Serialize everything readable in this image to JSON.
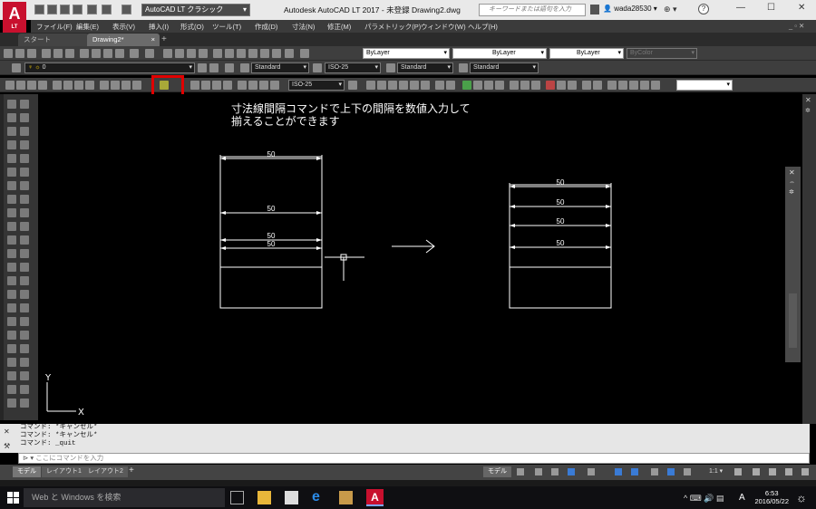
{
  "app": {
    "logo": "A",
    "logo_sub": "LT",
    "workspace": "AutoCAD LT クラシック",
    "title": "Autodesk AutoCAD LT 2017 - 未登録    Drawing2.dwg",
    "search_placeholder": "キーワードまたは語句を入力",
    "user": "wada28530",
    "help": "?"
  },
  "menus": [
    "ファイル(F)",
    "編集(E)",
    "表示(V)",
    "挿入(I)",
    "形式(O)",
    "ツール(T)",
    "作成(D)",
    "寸法(N)",
    "修正(M)",
    "パラメトリック(P)",
    "ウィンドウ(W)",
    "ヘルプ(H)"
  ],
  "tabs": [
    {
      "label": "スタート"
    },
    {
      "label": "Drawing2*"
    }
  ],
  "toolbars": {
    "layer_color": "ByLayer",
    "layer_linetype": "ByLayer",
    "layer_lineweight": "ByLayer",
    "plot_style": "ByColor",
    "layer_name": "0",
    "text_style": "Standard",
    "dim_style": "ISO-25",
    "table_style": "Standard",
    "multileader_style": "Standard",
    "dim_style_2": "ISO-25"
  },
  "annotation": [
    "寸法線間隔コマンドで上下の間隔を数値入力して",
    "揃えることができます"
  ],
  "dims": {
    "left": [
      "50",
      "50",
      "50",
      "50"
    ],
    "right": [
      "50",
      "50",
      "50",
      "50"
    ]
  },
  "ucs": {
    "x": "X",
    "y": "Y"
  },
  "command_history": [
    "コマンド: *キャンセル*",
    "コマンド: *キャンセル*",
    "コマンド: _quit"
  ],
  "command_placeholder": "ここにコマンドを入力",
  "layout_tabs": [
    {
      "label": "モデル"
    },
    {
      "label": "レイアウト1"
    },
    {
      "label": "レイアウト2"
    }
  ],
  "status": {
    "model": "モデル",
    "scale": "1:1"
  },
  "taskbar": {
    "search": "Web と Windows を検索",
    "ime": "A",
    "time": "6:53",
    "date": "2016/05/22"
  }
}
